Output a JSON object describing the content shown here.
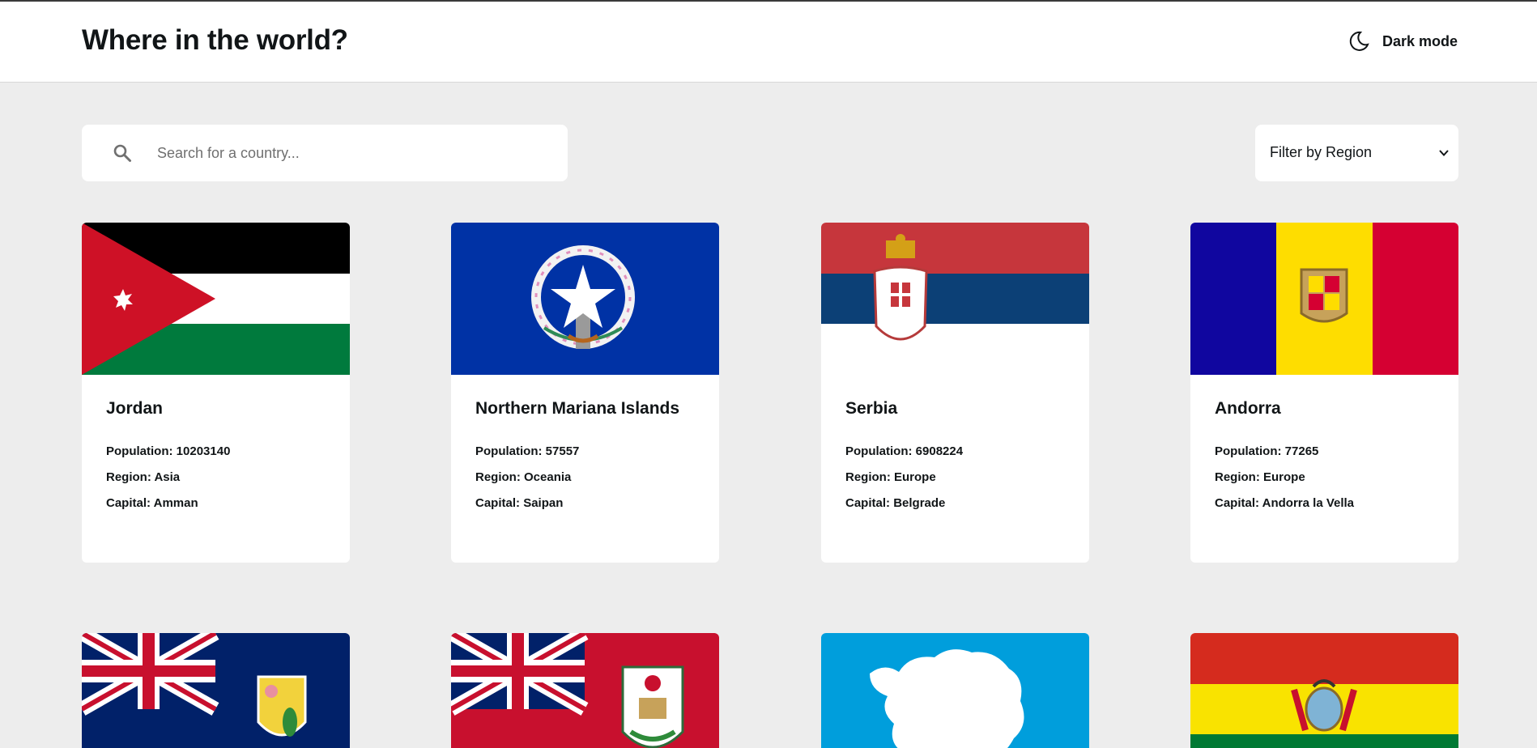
{
  "header": {
    "title": "Where in the world?",
    "theme_toggle": {
      "label": "Dark mode",
      "icon": "moon-icon"
    }
  },
  "search": {
    "placeholder": "Search for a country...",
    "value": "",
    "icon": "search-icon"
  },
  "filter": {
    "label": "Filter by Region",
    "icon": "chevron-down-icon"
  },
  "labels": {
    "population": "Population:",
    "region": "Region:",
    "capital": "Capital:"
  },
  "countries": [
    {
      "name": "Jordan",
      "population": "10203140",
      "region": "Asia",
      "capital": "Amman",
      "flag": "jordan-flag"
    },
    {
      "name": "Northern Mariana Islands",
      "population": "57557",
      "region": "Oceania",
      "capital": "Saipan",
      "flag": "northern-mariana-islands-flag"
    },
    {
      "name": "Serbia",
      "population": "6908224",
      "region": "Europe",
      "capital": "Belgrade",
      "flag": "serbia-flag"
    },
    {
      "name": "Andorra",
      "population": "77265",
      "region": "Europe",
      "capital": "Andorra la Vella",
      "flag": "andorra-flag"
    },
    {
      "flag": "turks-and-caicos-flag"
    },
    {
      "flag": "bermuda-flag"
    },
    {
      "flag": "antarctica-flag"
    },
    {
      "flag": "bolivia-flag"
    }
  ],
  "colors": {
    "background": "#ededed",
    "surface": "#ffffff",
    "text": "#111517"
  }
}
